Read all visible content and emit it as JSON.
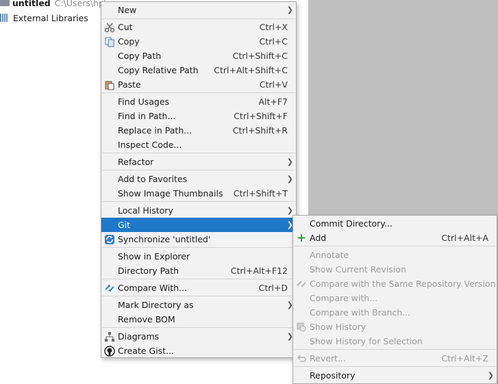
{
  "project": {
    "root_name": "untitled",
    "root_path": "C:\\Users\\hp\\",
    "external_libraries": "External Libraries"
  },
  "context_menu": {
    "items": [
      {
        "label": "New",
        "shortcut": "",
        "submenu": true
      },
      {
        "label": "Cut",
        "shortcut": "Ctrl+X",
        "icon": "scissors-icon"
      },
      {
        "label": "Copy",
        "shortcut": "Ctrl+C",
        "icon": "copy-icon"
      },
      {
        "label": "Copy Path",
        "shortcut": "Ctrl+Shift+C"
      },
      {
        "label": "Copy Relative Path",
        "shortcut": "Ctrl+Alt+Shift+C"
      },
      {
        "label": "Paste",
        "shortcut": "Ctrl+V",
        "icon": "paste-icon"
      },
      {
        "label": "Find Usages",
        "shortcut": "Alt+F7"
      },
      {
        "label": "Find in Path...",
        "shortcut": "Ctrl+Shift+F"
      },
      {
        "label": "Replace in Path...",
        "shortcut": "Ctrl+Shift+R"
      },
      {
        "label": "Inspect Code...",
        "shortcut": ""
      },
      {
        "label": "Refactor",
        "shortcut": "",
        "submenu": true
      },
      {
        "label": "Add to Favorites",
        "shortcut": "",
        "submenu": true
      },
      {
        "label": "Show Image Thumbnails",
        "shortcut": "Ctrl+Shift+T"
      },
      {
        "label": "Local History",
        "shortcut": "",
        "submenu": true
      },
      {
        "label": "Git",
        "shortcut": "",
        "submenu": true,
        "selected": true
      },
      {
        "label": "Synchronize 'untitled'",
        "shortcut": "",
        "icon": "sync-icon"
      },
      {
        "label": "Show in Explorer",
        "shortcut": ""
      },
      {
        "label": "Directory Path",
        "shortcut": "Ctrl+Alt+F12"
      },
      {
        "label": "Compare With...",
        "shortcut": "Ctrl+D",
        "icon": "compare-icon"
      },
      {
        "label": "Mark Directory as",
        "shortcut": "",
        "submenu": true
      },
      {
        "label": "Remove BOM",
        "shortcut": ""
      },
      {
        "label": "Diagrams",
        "shortcut": "",
        "submenu": true,
        "icon": "diagram-icon"
      },
      {
        "label": "Create Gist...",
        "shortcut": "",
        "icon": "github-icon"
      }
    ]
  },
  "git_submenu": {
    "items": [
      {
        "label": "Commit Directory...",
        "shortcut": ""
      },
      {
        "label": "Add",
        "shortcut": "Ctrl+Alt+A",
        "icon": "plus-icon"
      },
      {
        "label": "Annotate",
        "shortcut": "",
        "disabled": true
      },
      {
        "label": "Show Current Revision",
        "shortcut": "",
        "disabled": true
      },
      {
        "label": "Compare with the Same Repository Version",
        "shortcut": "",
        "disabled": true,
        "icon": "compare-icon"
      },
      {
        "label": "Compare with...",
        "shortcut": "",
        "disabled": true
      },
      {
        "label": "Compare with Branch...",
        "shortcut": "",
        "disabled": true
      },
      {
        "label": "Show History",
        "shortcut": "",
        "disabled": true,
        "icon": "history-icon"
      },
      {
        "label": "Show History for Selection",
        "shortcut": "",
        "disabled": true
      },
      {
        "label": "Revert...",
        "shortcut": "Ctrl+Alt+Z",
        "disabled": true,
        "icon": "revert-icon"
      },
      {
        "label": "Repository",
        "shortcut": "",
        "submenu": true
      }
    ]
  },
  "colors": {
    "selection": "#1f78c8",
    "menu_bg": "#f2f2f2",
    "editor_bg": "#bfbfbf"
  }
}
